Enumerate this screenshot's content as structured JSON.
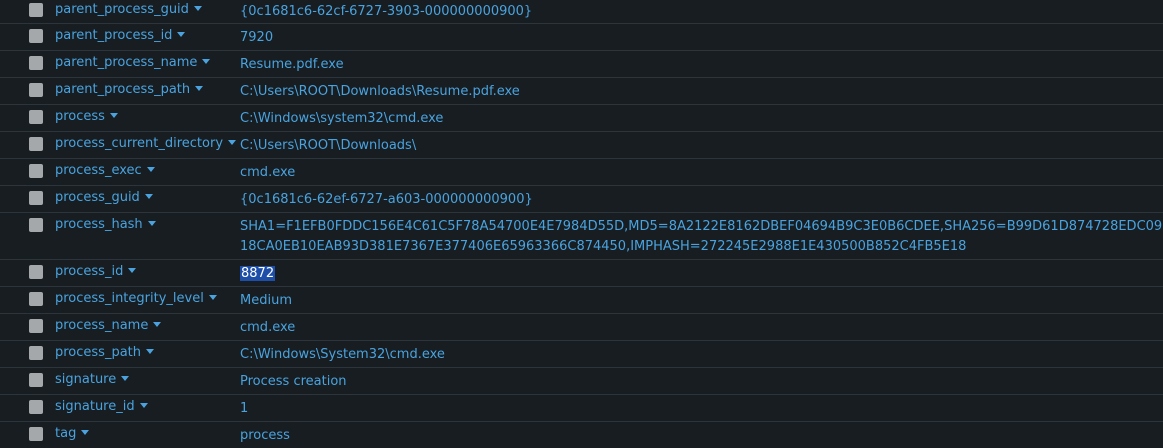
{
  "fields": [
    {
      "name": "parent_process_guid",
      "value": "{0c1681c6-62cf-6727-3903-000000000900}"
    },
    {
      "name": "parent_process_id",
      "value": "7920"
    },
    {
      "name": "parent_process_name",
      "value": "Resume.pdf.exe"
    },
    {
      "name": "parent_process_path",
      "value": "C:\\Users\\ROOT\\Downloads\\Resume.pdf.exe"
    },
    {
      "name": "process",
      "value": "C:\\Windows\\system32\\cmd.exe"
    },
    {
      "name": "process_current_directory",
      "value": "C:\\Users\\ROOT\\Downloads\\"
    },
    {
      "name": "process_exec",
      "value": "cmd.exe"
    },
    {
      "name": "process_guid",
      "value": "{0c1681c6-62ef-6727-a603-000000000900}"
    },
    {
      "name": "process_hash",
      "value": "SHA1=F1EFB0FDDC156E4C61C5F78A54700E4E7984D55D,MD5=8A2122E8162DBEF04694B9C3E0B6CDEE,SHA256=B99D61D874728EDC0918CA0EB10EAB93D381E7367E377406E65963366C874450,IMPHASH=272245E2988E1E430500B852C4FB5E18"
    },
    {
      "name": "process_id",
      "value": "8872"
    },
    {
      "name": "process_integrity_level",
      "value": "Medium"
    },
    {
      "name": "process_name",
      "value": "cmd.exe"
    },
    {
      "name": "process_path",
      "value": "C:\\Windows\\System32\\cmd.exe"
    },
    {
      "name": "signature",
      "value": "Process creation"
    },
    {
      "name": "signature_id",
      "value": "1"
    },
    {
      "name": "tag",
      "value": "process"
    }
  ],
  "colors": {
    "background": "#171d21",
    "field_text": "#4aa3df",
    "checkbox": "#a4a8ab",
    "selection": "#1e4fa8"
  }
}
